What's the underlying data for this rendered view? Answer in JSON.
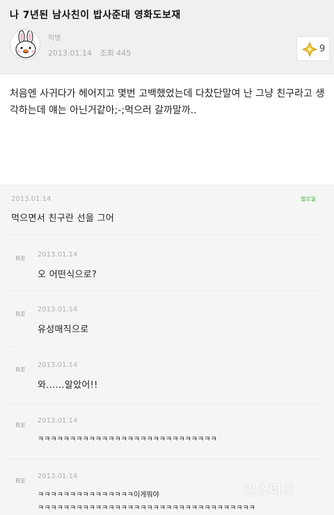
{
  "post": {
    "title": "나 7년된 남사친이 밥사준대 영화도보재",
    "author": "익명",
    "date": "2013.01.14",
    "views_label": "조회 445",
    "like_count": "9",
    "body": "처음엔 사귀다가 헤어지고 몇번 고백했었는데 다찼단말여 난 그냥 친구라고 생각하는데 얘는 아닌거같아;-;먹으러 갈까말까.."
  },
  "comments": [
    {
      "date": "2013.01.14",
      "badge": "헬로월",
      "text": "먹으면서 친구란 선을 그어",
      "reply": false
    },
    {
      "date": "2013.01.14",
      "re": "RE",
      "text": "오 어떤식으로?",
      "reply": true
    },
    {
      "date": "2013.01.14",
      "re": "RE",
      "text": "유성매직으로",
      "reply": true
    },
    {
      "date": "2013.01.14",
      "re": "RE",
      "text": "와......알았어!!",
      "reply": true
    },
    {
      "date": "2013.01.14",
      "re": "RE",
      "text": "ㅋㅋㅋㅋㅋㅋㅋㅋㅋㅋㅋㅋㅋㅋㅋㅋㅋㅋㅋㅋㅋㅋㅋㅋㅋㅋㅋㅋ",
      "reply": true
    },
    {
      "date": "2013.01.14",
      "re": "RE",
      "text": "ㅋㅋㅋㅋㅋㅋㅋㅋㅋㅋㅋㅋㅋㅋㅋ이게뭐야",
      "text2": "ㅋㅋㅋㅋㅋㅋㅋㅋㅋㅋㅋㅋㅋㅋㅋㅋㅋㅋㅋㅋㅋㅋㅋㅋㅋㅋㅋㅋㅋㅋㅋㅋㅋㅋ",
      "reply": true
    }
  ],
  "watermark": "인스티즈",
  "colors": {
    "like_icon": "#e8b923",
    "avatar_face": "#b8860b",
    "badge": "#55b555"
  },
  "icons": {
    "avatar": "bunny-avatar-icon",
    "like": "diamond-sparkle-icon"
  }
}
